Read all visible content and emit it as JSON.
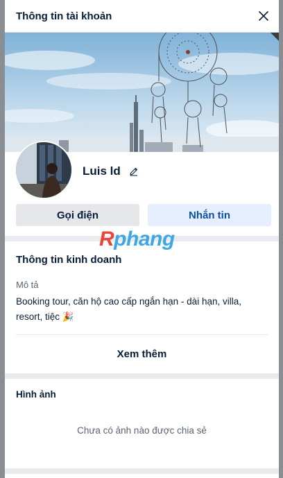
{
  "header": {
    "title": "Thông tin tài khoản",
    "close_icon": "close-icon"
  },
  "profile": {
    "name": "Luis ld",
    "edit_icon": "pencil-icon",
    "call_label": "Gọi điện",
    "message_label": "Nhắn tin"
  },
  "watermark": {
    "part1": "R",
    "part2": "phang"
  },
  "business": {
    "title": "Thông tin kinh doanh",
    "description_label": "Mô tả",
    "description": "Booking tour, căn hộ cao cấp ngắn hạn - dài hạn, villa, resort, tiệc 🎉",
    "see_more": "Xem thêm"
  },
  "images": {
    "title": "Hình ảnh",
    "empty_text": "Chưa có ảnh nào được chia sẻ"
  },
  "colors": {
    "accent": "#0d4fa6",
    "accent_bg": "#e5efff",
    "text": "#081c36",
    "muted": "#5a6372"
  }
}
